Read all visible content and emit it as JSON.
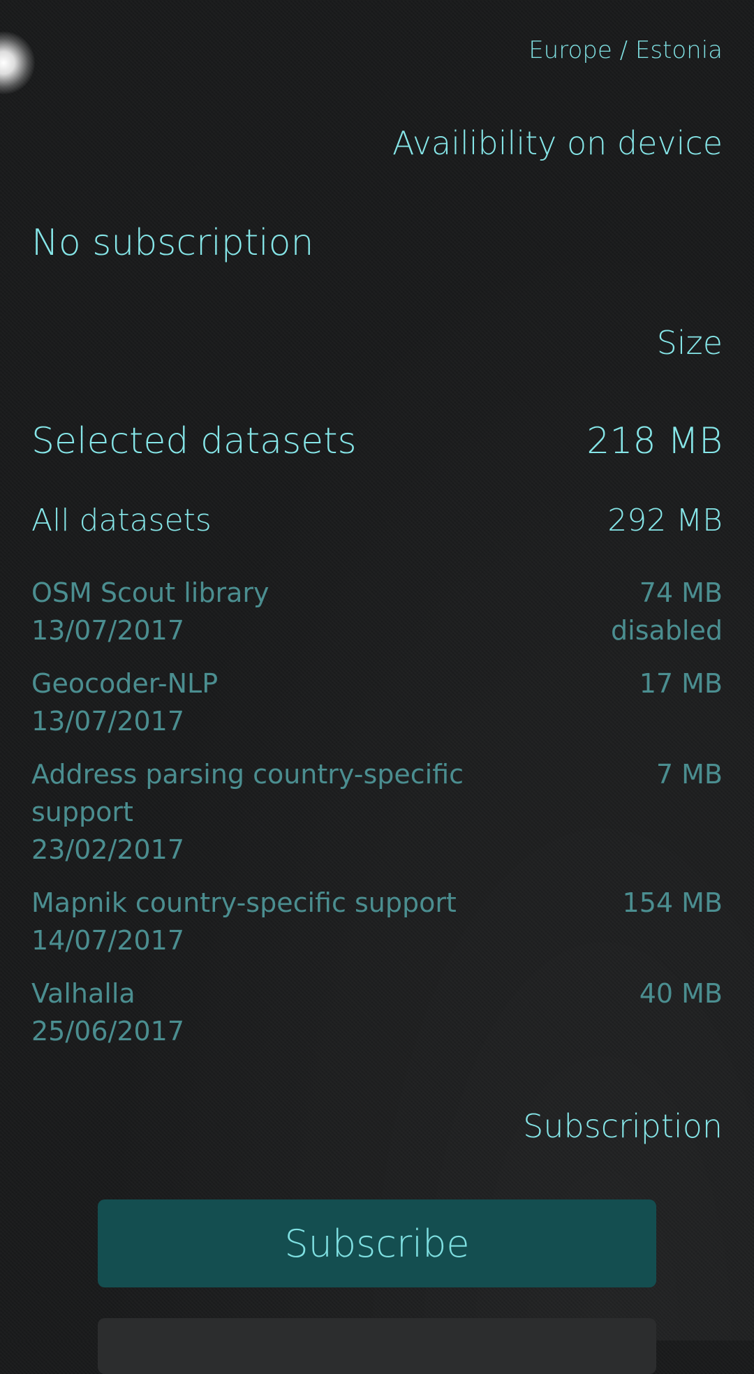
{
  "header": {
    "breadcrumb": "Europe / Estonia"
  },
  "availability": {
    "section_label": "Availibility on device",
    "status": "No subscription"
  },
  "size_section": {
    "label": "Size",
    "selected": {
      "label": "Selected datasets",
      "value": "218 MB"
    },
    "all": {
      "label": "All datasets",
      "value": "292 MB"
    }
  },
  "datasets": [
    {
      "name": "OSM Scout library",
      "date": "13/07/2017",
      "size": "74 MB",
      "status": "disabled"
    },
    {
      "name": "Geocoder-NLP",
      "date": "13/07/2017",
      "size": "17 MB",
      "status": ""
    },
    {
      "name": "Address parsing country-specific support",
      "date": "23/02/2017",
      "size": "7 MB",
      "status": ""
    },
    {
      "name": "Mapnik country-specific support",
      "date": "14/07/2017",
      "size": "154 MB",
      "status": ""
    },
    {
      "name": "Valhalla",
      "date": "25/06/2017",
      "size": "40 MB",
      "status": ""
    }
  ],
  "subscription": {
    "section_label": "Subscription",
    "subscribe_label": "Subscribe"
  }
}
